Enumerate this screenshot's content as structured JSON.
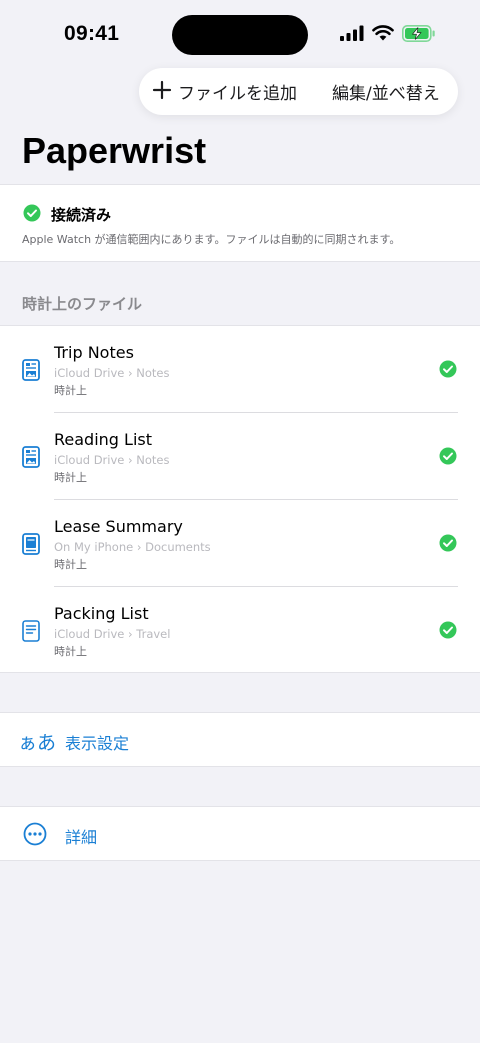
{
  "status_bar": {
    "time": "09:41"
  },
  "toolbar": {
    "add_file_label": "ファイルを追加",
    "edit_sort_label": "編集/並べ替え"
  },
  "app": {
    "title": "Paperwrist"
  },
  "connection": {
    "status": "接続済み",
    "description": "Apple Watch が通信範囲内にあります。ファイルは自動的に同期されます。"
  },
  "files_section": {
    "header": "時計上のファイル"
  },
  "files": [
    {
      "name": "Trip Notes",
      "path": "iCloud Drive › Notes",
      "location": "時計上",
      "icon": "photo-doc-icon"
    },
    {
      "name": "Reading List",
      "path": "iCloud Drive › Notes",
      "location": "時計上",
      "icon": "photo-doc-icon"
    },
    {
      "name": "Lease Summary",
      "path": "On My iPhone › Documents",
      "location": "時計上",
      "icon": "book-doc-icon"
    },
    {
      "name": "Packing List",
      "path": "iCloud Drive › Travel",
      "location": "時計上",
      "icon": "text-doc-icon"
    }
  ],
  "display_settings": {
    "glyph": "ぁあ",
    "label": "表示設定"
  },
  "details": {
    "label": "詳細"
  },
  "colors": {
    "accent": "#1a7fd4",
    "success": "#34c759",
    "battery": "#34c759"
  }
}
